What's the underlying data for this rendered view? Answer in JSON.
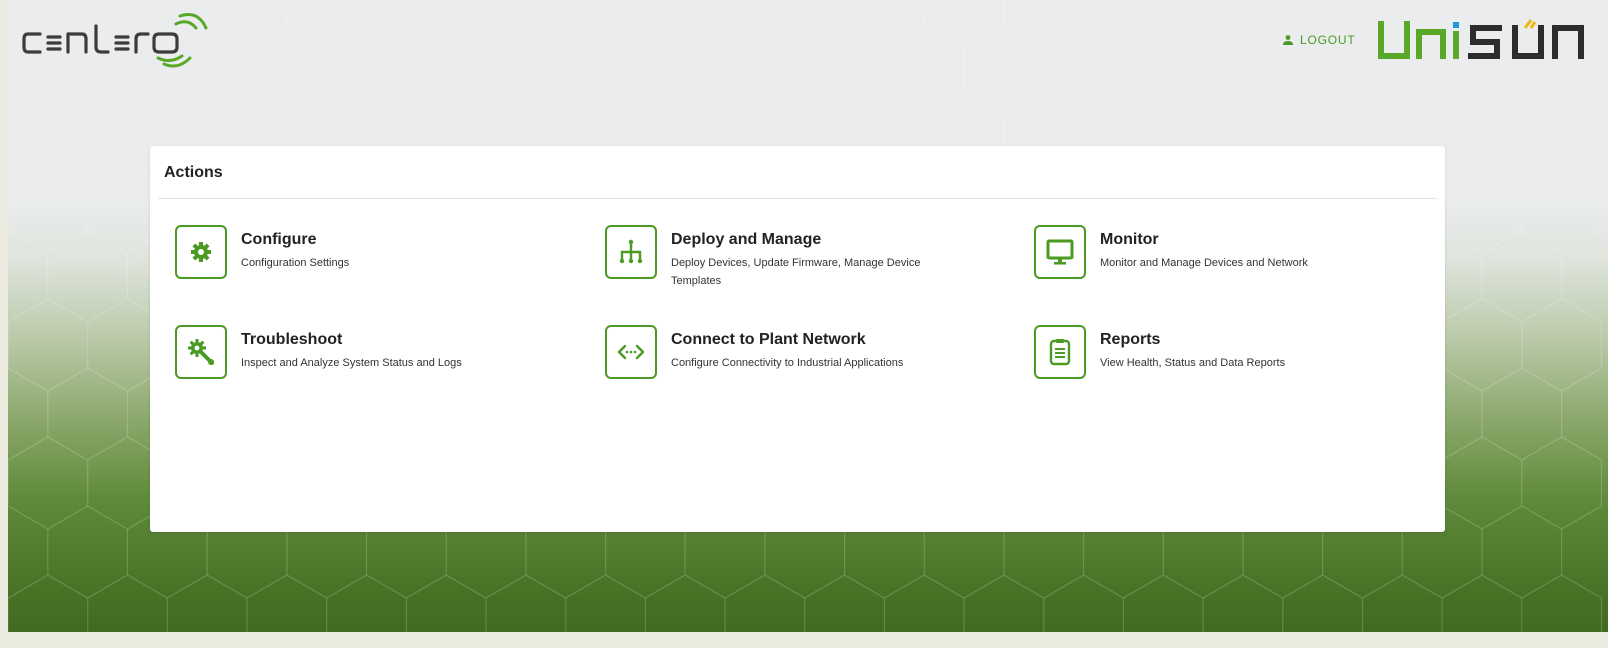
{
  "brand": {
    "name": "centero",
    "partner": "unison",
    "accent_color": "#4a9a24",
    "logout_label": "LOGOUT",
    "logout_icon": "person-icon"
  },
  "actions_panel": {
    "title": "Actions",
    "items": [
      {
        "title": "Configure",
        "description": "Configuration Settings",
        "icon": "gear-icon"
      },
      {
        "title": "Deploy and Manage",
        "description": "Deploy Devices, Update Firmware, Manage Device Templates",
        "icon": "network-deploy-icon"
      },
      {
        "title": "Monitor",
        "description": "Monitor and Manage Devices and Network",
        "icon": "monitor-icon"
      },
      {
        "title": "Troubleshoot",
        "description": "Inspect and Analyze System Status and Logs",
        "icon": "gear-wrench-icon"
      },
      {
        "title": "Connect to Plant Network",
        "description": "Configure Connectivity to Industrial Applications",
        "icon": "code-connect-icon"
      },
      {
        "title": "Reports",
        "description": "View Health, Status and Data Reports",
        "icon": "clipboard-icon"
      }
    ]
  }
}
